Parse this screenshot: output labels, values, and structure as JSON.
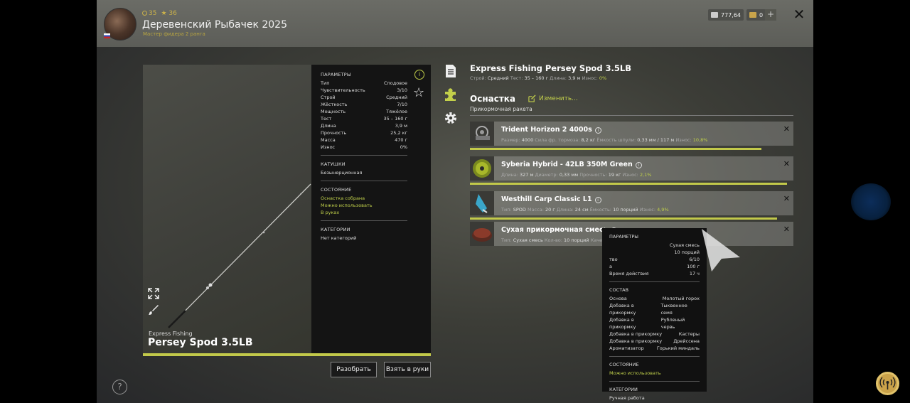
{
  "header": {
    "coins": "35",
    "stars": "36",
    "username": "Деревенский Рыбачек 2025",
    "rank": "Мастер фидера 2 ранга",
    "silver": "777,64",
    "gold": "0",
    "plus": "+",
    "close": "✕"
  },
  "rod": {
    "brand": "Express Fishing",
    "name": "Persey Spod 3.5LB",
    "params_title": "ПАРАМЕТРЫ",
    "params": [
      {
        "k": "Тип",
        "v": "Сподовое"
      },
      {
        "k": "Чувствительность",
        "v": "3/10"
      },
      {
        "k": "Строй",
        "v": "Средний"
      },
      {
        "k": "Жёсткость",
        "v": "7/10"
      },
      {
        "k": "Мощность",
        "v": "Тяжёлое"
      },
      {
        "k": "Тест",
        "v": "35 – 160 г"
      },
      {
        "k": "Длина",
        "v": "3,9 м"
      },
      {
        "k": "Прочность",
        "v": "25,2 кг"
      },
      {
        "k": "Масса",
        "v": "470 г"
      },
      {
        "k": "Износ",
        "v": "0%"
      }
    ],
    "reels_title": "КАТУШКИ",
    "reels_value": "Безынерционная",
    "state_title": "СОСТОЯНИЕ",
    "state_1": "Оснастка собрана",
    "state_2": "Можно использовать",
    "state_3": "В руках",
    "cat_title": "КАТЕГОРИИ",
    "cat_value": "Нет категорий",
    "btn_disassemble": "Разобрать",
    "btn_take": "Взять в руки",
    "help": "?"
  },
  "details": {
    "title": "Express Fishing Persey Spod 3.5LB",
    "sub_strey_label": "Строй:",
    "sub_strey": "Средний",
    "sub_test_label": "Тест:",
    "sub_test": "35 – 160 г",
    "sub_len_label": "Длина:",
    "sub_len": "3,9 м",
    "sub_wear_label": "Износ:",
    "sub_wear": "0%",
    "rig_title": "Оснастка",
    "rig_edit": "Изменить...",
    "rig_type": "Прикормочная ракета"
  },
  "items": [
    {
      "name": "Trident Horizon 2 4000s",
      "detail_parts": [
        [
          "Размер:",
          "4000"
        ],
        [
          "Сила фр. тормоза:",
          "8,2 кг"
        ],
        [
          "Ёмкость шпули:",
          "0,33 мм / 117 м"
        ]
      ],
      "wear_label": "Износ:",
      "wear": "10,8%",
      "remaining": 0.9
    },
    {
      "name": "Syberia Hybrid - 42LB 350M Green",
      "detail_parts": [
        [
          "Длина:",
          "327 м"
        ],
        [
          "Диаметр:",
          "0,33 мм"
        ],
        [
          "Прочность:",
          "19 кг"
        ]
      ],
      "wear_label": "Износ:",
      "wear": "2,1%",
      "remaining": 0.98
    },
    {
      "name": "Westhill Carp Classic L1",
      "detail_parts": [
        [
          "Тип:",
          "SPOD"
        ],
        [
          "Масса:",
          "20 г"
        ],
        [
          "Длина:",
          "24 см"
        ],
        [
          "Ёмкость:",
          "10 порций"
        ]
      ],
      "wear_label": "Износ:",
      "wear": "4,9%",
      "remaining": 0.95
    },
    {
      "name": "Сухая прикормочная смесь",
      "detail_parts": [
        [
          "Тип:",
          "Сухая смесь"
        ],
        [
          "Кол-во:",
          "10 порций"
        ],
        [
          "Качест",
          ""
        ]
      ],
      "wear_label": "",
      "wear": "",
      "remaining": 0
    }
  ],
  "tooltip": {
    "params_title": "ПАРАМЕТРЫ",
    "params": [
      {
        "k": "",
        "v": "Сухая смесь"
      },
      {
        "k": "",
        "v": "10 порций"
      },
      {
        "k": "тво",
        "v": "6/10"
      },
      {
        "k": "а",
        "v": "100 г"
      },
      {
        "k": "Время действия",
        "v": "17 ч"
      }
    ],
    "composition_title": "СОСТАВ",
    "composition": [
      {
        "k": "Основа",
        "v": "Молотый горох"
      },
      {
        "k": "Добавка в прикормку",
        "v": "Тыквенное семя"
      },
      {
        "k": "Добавка в прикормку",
        "v": "Рубленый червь"
      },
      {
        "k": "Добавка в прикормку",
        "v": "Кастеры"
      },
      {
        "k": "Добавка в прикормку",
        "v": "Дрейссена"
      },
      {
        "k": "Ароматизатор",
        "v": "Горький миндаль"
      }
    ],
    "state_title": "СОСТОЯНИЕ",
    "state_value": "Можно использовать",
    "cat_title": "КАТЕГОРИИ",
    "cat_value": "Ручная работа"
  },
  "colors": {
    "accent": "#c2c94a",
    "panel_dark": "#141414",
    "text": "#dddddd"
  }
}
